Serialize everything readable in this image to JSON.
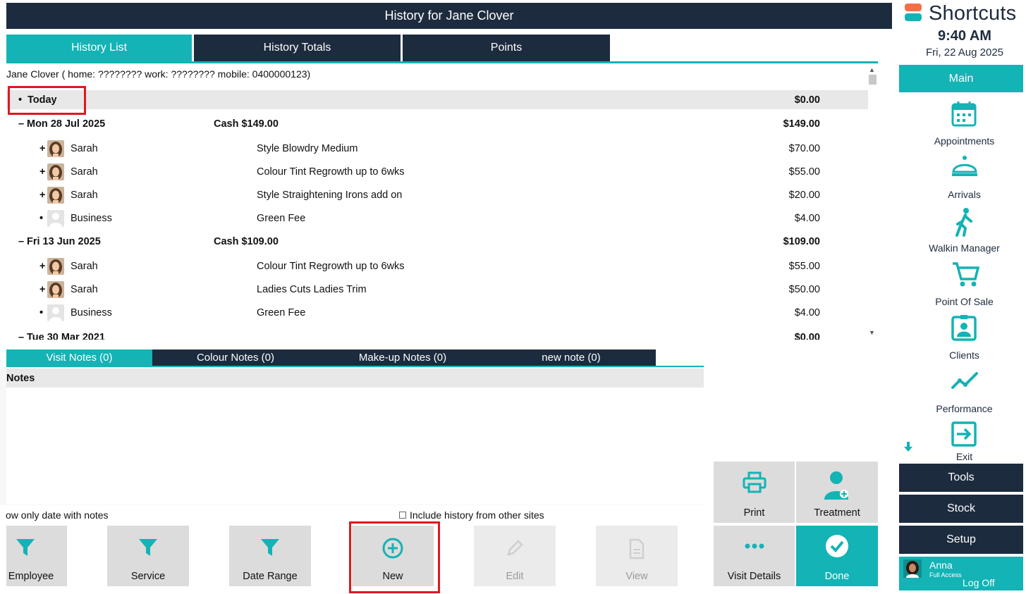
{
  "window": {
    "title": "History for Jane Clover"
  },
  "tabs": [
    {
      "label": "History List",
      "active": true
    },
    {
      "label": "History Totals",
      "active": false
    },
    {
      "label": "Points",
      "active": false
    }
  ],
  "client": {
    "name": "Jane Clover",
    "info": "Jane Clover ( home: ???????? work: ???????? mobile: 0400000123)"
  },
  "history": {
    "today": {
      "label": "Today",
      "total": "$0.00"
    },
    "visits": [
      {
        "date": "Mon 28 Jul 2025",
        "payment": "Cash $149.00",
        "total": "$149.00",
        "items": [
          {
            "marker": "+",
            "staff": "Sarah",
            "avatar": "staff",
            "service": "Style Blowdry Medium",
            "price": "$70.00"
          },
          {
            "marker": "+",
            "staff": "Sarah",
            "avatar": "staff",
            "service": "Colour Tint Regrowth up to 6wks",
            "price": "$55.00"
          },
          {
            "marker": "+",
            "staff": "Sarah",
            "avatar": "staff",
            "service": "Style Straightening Irons add on",
            "price": "$20.00"
          },
          {
            "marker": "•",
            "staff": "Business",
            "avatar": "business",
            "service": "Green Fee",
            "price": "$4.00"
          }
        ]
      },
      {
        "date": "Fri 13 Jun 2025",
        "payment": "Cash $109.00",
        "total": "$109.00",
        "items": [
          {
            "marker": "+",
            "staff": "Sarah",
            "avatar": "staff",
            "service": "Colour Tint Regrowth up to 6wks",
            "price": "$55.00"
          },
          {
            "marker": "+",
            "staff": "Sarah",
            "avatar": "staff",
            "service": "Ladies Cuts Ladies Trim",
            "price": "$50.00"
          },
          {
            "marker": "•",
            "staff": "Business",
            "avatar": "business",
            "service": "Green Fee",
            "price": "$4.00"
          }
        ]
      },
      {
        "date": "Tue 30 Mar 2021",
        "payment": "",
        "total": "$0.00",
        "items": []
      }
    ]
  },
  "notes_tabs": [
    {
      "label": "Visit Notes (0)",
      "active": true
    },
    {
      "label": "Colour Notes (0)",
      "active": false
    },
    {
      "label": "Make-up Notes (0)",
      "active": false
    },
    {
      "label": "new note (0)",
      "active": false
    }
  ],
  "notes": {
    "header": "Notes"
  },
  "options": {
    "show_only_notes": "ow only date with notes",
    "include_other_sites": "Include history from other sites"
  },
  "buttons": {
    "employee": "Employee",
    "service": "Service",
    "date_range": "Date Range",
    "new": "New",
    "edit": "Edit",
    "view": "View",
    "print": "Print",
    "treatment": "Treatment",
    "visit_details": "Visit Details",
    "done": "Done"
  },
  "sidebar": {
    "app_name": "Shortcuts",
    "time": "9:40 AM",
    "date": "Fri, 22 Aug 2025",
    "main": "Main",
    "nav": [
      {
        "label": "Appointments",
        "icon": "calendar-icon"
      },
      {
        "label": "Arrivals",
        "icon": "bell-icon"
      },
      {
        "label": "Walkin Manager",
        "icon": "walking-person-icon"
      },
      {
        "label": "Point Of Sale",
        "icon": "cart-icon"
      },
      {
        "label": "Clients",
        "icon": "client-card-icon"
      },
      {
        "label": "Performance",
        "icon": "trend-line-icon"
      },
      {
        "label": "Exit",
        "icon": "exit-icon"
      }
    ],
    "tools": "Tools",
    "stock": "Stock",
    "setup": "Setup",
    "user": {
      "name": "Anna",
      "role": "Full Access",
      "logoff": "Log Off"
    }
  },
  "colors": {
    "teal": "#14b3b5",
    "navy": "#1d2b3e",
    "highlight": "#e1181f"
  }
}
